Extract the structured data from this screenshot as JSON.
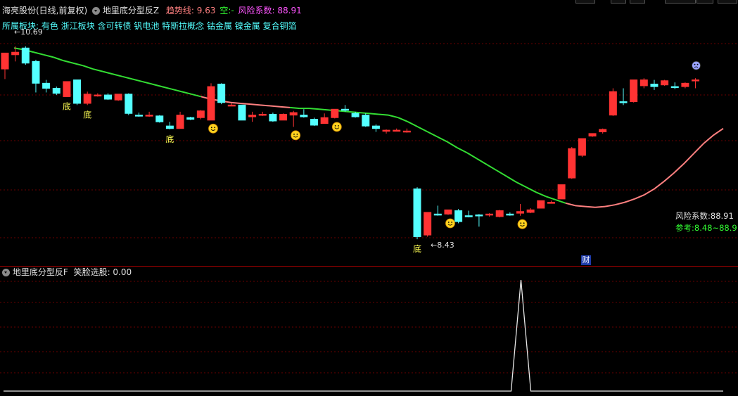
{
  "colors": {
    "up": "#ff3333",
    "down": "#54ffff",
    "trend_up": "#ff8080",
    "trend_down": "#33dd33",
    "grid": "#6a0000",
    "separator": "#8b0000",
    "yellow": "#ffff55",
    "cyan": "#54ffff",
    "magenta": "#ff55ff",
    "green": "#33ff33",
    "white": "#e0e0e0"
  },
  "header": {
    "stock_title": "海亮股份(日线,前复权)",
    "indicator_name": "地里底分型反Z",
    "trend_label": "趋势线: 9.63",
    "empty_label": "空:-",
    "risk_label": "风险系数: 88.91"
  },
  "sector": {
    "label": "所属板块:",
    "tags": "有色 浙江板块 含可转债 钒电池 特斯拉概念 钴金属 镍金属 复合铜箔"
  },
  "annotations": {
    "high_price": "10.69",
    "low_price": "8.43",
    "bottom_mark": "底",
    "finance_mark": "财",
    "smile_icon": "smiling-face-icon",
    "alarm_icon": "warning-face-icon"
  },
  "right_panel": {
    "risk": "风险系数:88.91",
    "reference": "参考:8.48~88.91"
  },
  "sub_header": {
    "indicator_name": "地里底分型反F",
    "value_label": "笑脸选股: 0.00"
  },
  "chart_data": {
    "type": "candlestick",
    "ylim": [
      8.3,
      10.85
    ],
    "candles": [
      [
        10.43,
        10.62,
        10.31,
        10.62
      ],
      [
        10.6,
        10.7,
        10.52,
        10.63
      ],
      [
        10.68,
        10.7,
        10.48,
        10.5
      ],
      [
        10.52,
        10.54,
        10.15,
        10.26
      ],
      [
        10.26,
        10.3,
        10.15,
        10.2
      ],
      [
        10.2,
        10.22,
        10.12,
        10.14
      ],
      [
        10.1,
        10.28,
        10.1,
        10.28
      ],
      [
        10.3,
        10.3,
        10.0,
        10.02
      ],
      [
        10.02,
        10.16,
        10.0,
        10.13
      ],
      [
        10.12,
        10.14,
        10.1,
        10.12
      ],
      [
        10.12,
        10.14,
        10.06,
        10.07
      ],
      [
        10.06,
        10.13,
        10.05,
        10.13
      ],
      [
        10.13,
        10.14,
        9.88,
        9.9
      ],
      [
        9.88,
        9.91,
        9.86,
        9.87
      ],
      [
        9.87,
        9.92,
        9.86,
        9.88
      ],
      [
        9.87,
        9.88,
        9.79,
        9.8
      ],
      [
        9.75,
        9.8,
        9.71,
        9.72
      ],
      [
        9.72,
        9.92,
        9.72,
        9.88
      ],
      [
        9.85,
        9.86,
        9.82,
        9.83
      ],
      [
        9.85,
        9.94,
        9.83,
        9.93
      ],
      [
        9.82,
        10.26,
        9.82,
        10.22
      ],
      [
        10.25,
        10.26,
        10.01,
        10.03
      ],
      [
        10.0,
        10.02,
        9.99,
        10.0
      ],
      [
        10.0,
        10.0,
        9.82,
        9.82
      ],
      [
        9.86,
        9.92,
        9.8,
        9.88
      ],
      [
        9.88,
        9.92,
        9.87,
        9.89
      ],
      [
        9.89,
        9.91,
        9.8,
        9.81
      ],
      [
        9.82,
        9.9,
        9.82,
        9.89
      ],
      [
        9.88,
        9.93,
        9.74,
        9.91
      ],
      [
        9.88,
        9.95,
        9.85,
        9.86
      ],
      [
        9.83,
        9.85,
        9.75,
        9.76
      ],
      [
        9.78,
        9.9,
        9.78,
        9.85
      ],
      [
        9.85,
        9.94,
        9.84,
        9.95
      ],
      [
        9.95,
        10.0,
        9.92,
        9.94
      ],
      [
        9.9,
        9.92,
        9.85,
        9.86
      ],
      [
        9.88,
        9.9,
        9.74,
        9.75
      ],
      [
        9.75,
        9.77,
        9.68,
        9.72
      ],
      [
        9.69,
        9.71,
        9.66,
        9.7
      ],
      [
        9.7,
        9.72,
        9.69,
        9.7
      ],
      [
        9.69,
        9.72,
        9.67,
        9.69
      ],
      [
        9.0,
        9.02,
        8.4,
        8.43
      ],
      [
        8.45,
        8.72,
        8.43,
        8.72
      ],
      [
        8.7,
        8.8,
        8.68,
        8.69
      ],
      [
        8.7,
        8.75,
        8.69,
        8.75
      ],
      [
        8.74,
        8.76,
        8.59,
        8.61
      ],
      [
        8.68,
        8.74,
        8.66,
        8.67
      ],
      [
        8.69,
        8.7,
        8.55,
        8.68
      ],
      [
        8.69,
        8.71,
        8.67,
        8.7
      ],
      [
        8.67,
        8.75,
        8.66,
        8.74
      ],
      [
        8.7,
        8.72,
        8.68,
        8.69
      ],
      [
        8.71,
        8.82,
        8.68,
        8.73
      ],
      [
        8.72,
        8.77,
        8.71,
        8.75
      ],
      [
        8.77,
        8.86,
        8.77,
        8.86
      ],
      [
        8.84,
        8.86,
        8.83,
        8.84
      ],
      [
        8.88,
        9.05,
        8.88,
        9.05
      ],
      [
        9.13,
        9.5,
        9.12,
        9.48
      ],
      [
        9.4,
        9.59,
        9.38,
        9.6
      ],
      [
        9.63,
        9.66,
        9.62,
        9.66
      ],
      [
        9.68,
        9.72,
        9.66,
        9.71
      ],
      [
        9.88,
        10.2,
        9.87,
        10.16
      ],
      [
        10.04,
        10.2,
        10.0,
        10.03
      ],
      [
        10.04,
        10.27,
        10.03,
        10.3
      ],
      [
        10.23,
        10.32,
        10.2,
        10.3
      ],
      [
        10.25,
        10.3,
        10.18,
        10.22
      ],
      [
        10.24,
        10.3,
        10.23,
        10.29
      ],
      [
        10.22,
        10.27,
        10.19,
        10.21
      ],
      [
        10.22,
        10.27,
        10.2,
        10.26
      ],
      [
        10.29,
        10.32,
        10.2,
        10.3
      ]
    ],
    "trend_line": [
      10.68,
      10.66,
      10.63,
      10.6,
      10.57,
      10.53,
      10.5,
      10.47,
      10.43,
      10.4,
      10.37,
      10.34,
      10.31,
      10.28,
      10.25,
      10.22,
      10.19,
      10.16,
      10.13,
      10.1,
      10.07,
      10.05,
      10.03,
      10.02,
      10.01,
      10.0,
      9.99,
      9.98,
      9.97,
      9.96,
      9.96,
      9.95,
      9.94,
      9.93,
      9.92,
      9.91,
      9.9,
      9.89,
      9.88,
      9.85,
      9.8,
      9.74,
      9.68,
      9.62,
      9.56,
      9.49,
      9.43,
      9.36,
      9.29,
      9.22,
      9.15,
      9.08,
      9.02,
      8.96,
      8.91,
      8.87,
      8.83,
      8.8,
      8.79,
      8.78,
      8.79,
      8.81,
      8.84,
      8.88,
      8.93,
      9.0,
      9.09,
      9.19,
      9.3,
      9.42,
      9.54,
      9.64,
      9.72
    ],
    "trend_uptrend_from_index": 19,
    "trend_downtrend_from_index": 28,
    "trend_uptrend2_from_index": 56,
    "bottom_marks": [
      6,
      8,
      16,
      40
    ],
    "smile_marks": [
      20,
      28,
      32,
      43,
      50
    ],
    "sub_signal": {
      "index": 50,
      "value": 1.0
    },
    "sub_ylim": [
      0,
      1
    ]
  }
}
